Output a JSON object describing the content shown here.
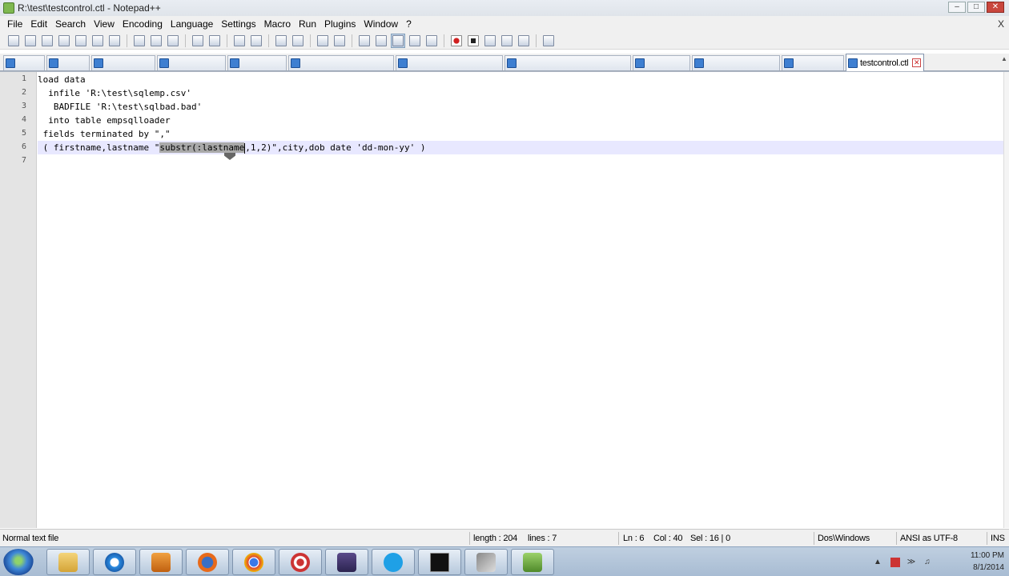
{
  "window": {
    "title": "R:\\test\\testcontrol.ctl - Notepad++",
    "minimize": "–",
    "maximize": "□",
    "close": "✕"
  },
  "menu": {
    "items": [
      "File",
      "Edit",
      "Search",
      "View",
      "Encoding",
      "Language",
      "Settings",
      "Macro",
      "Run",
      "Plugins",
      "Window",
      "?"
    ],
    "close_label": "X"
  },
  "toolbar": {
    "icons": [
      "new-file-icon",
      "open-file-icon",
      "save-icon",
      "save-all-icon",
      "close-icon",
      "close-all-icon",
      "print-icon",
      "cut-icon",
      "copy-icon",
      "paste-icon",
      "undo-icon",
      "redo-icon",
      "find-icon",
      "replace-icon",
      "zoom-in-icon",
      "zoom-out-icon",
      "sync-vertical-icon",
      "sync-horizontal-icon",
      "word-wrap-icon",
      "show-all-chars-icon",
      "indent-guide-icon",
      "user-defined-language-icon",
      "doc-map-icon",
      "record-macro-icon",
      "stop-record-icon",
      "play-macro-icon",
      "run-macro-multiple-icon",
      "save-macro-icon",
      "folder-as-workspace-icon"
    ]
  },
  "tabs": {
    "active_label": "testcontrol.ctl",
    "close_symbol": "✕"
  },
  "editor": {
    "lines": [
      {
        "num": "1",
        "text": "load data"
      },
      {
        "num": "2",
        "text": "  infile 'R:\\test\\sqlemp.csv'"
      },
      {
        "num": "3",
        "text": "   BADFILE 'R:\\test\\sqlbad.bad'"
      },
      {
        "num": "4",
        "text": "  into table empsqlloader"
      },
      {
        "num": "5",
        "text": " fields terminated by \",\""
      },
      {
        "num": "6",
        "before": " ( firstname,lastname \"",
        "selected": "substr(:lastname",
        "after": ",1,2)\",city,dob date 'dd-mon-yy' )"
      },
      {
        "num": "7",
        "text": ""
      }
    ],
    "current_line": 6
  },
  "status": {
    "file_type": "Normal text file",
    "length": "length : 204",
    "lines": "lines : 7",
    "ln": "Ln : 6",
    "col": "Col : 40",
    "sel": "Sel : 16 | 0",
    "eol": "Dos\\Windows",
    "encoding": "ANSI as UTF-8",
    "mode": "INS"
  },
  "taskbar": {
    "apps": [
      "file-explorer",
      "internet-explorer",
      "media-player",
      "firefox",
      "chrome",
      "screen-recorder",
      "game-app",
      "skype",
      "command-prompt",
      "sql-developer",
      "notepad-plus-plus"
    ],
    "clock_time": "11:00 PM",
    "clock_date": "8/1/2014"
  },
  "colors": {
    "current_line": "#e8e8ff",
    "selection": "#a9a9a9",
    "gutter": "#e4e4e4"
  }
}
